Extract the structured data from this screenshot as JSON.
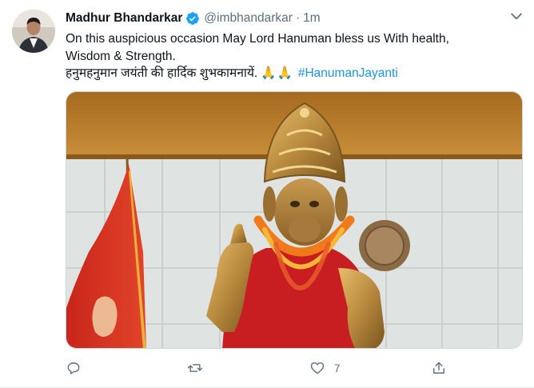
{
  "tweet": {
    "author": {
      "name": "Madhur Bhandarkar",
      "handle": "@imbhandarkar",
      "verified": true
    },
    "separator": "·",
    "timestamp": "1m",
    "text_lines": [
      "On this auspicious occasion May Lord Hanuman bless us With health,",
      "Wisdom & Strength."
    ],
    "hindi_text": "हनुमहनुमान जयंती की हार्दिक शुभकामनायें.",
    "emoji": "🙏🙏",
    "hashtag": "#HanumanJayanti",
    "actions": {
      "reply_count": "",
      "retweet_count": "",
      "like_count": "7"
    },
    "icons": [
      "verified-badge-icon",
      "chevron-down-icon",
      "reply-icon",
      "retweet-icon",
      "like-icon",
      "share-icon"
    ],
    "colors": {
      "link": "#1b95e0",
      "verified": "#1da1f2",
      "secondary_text": "#5b7083"
    }
  }
}
